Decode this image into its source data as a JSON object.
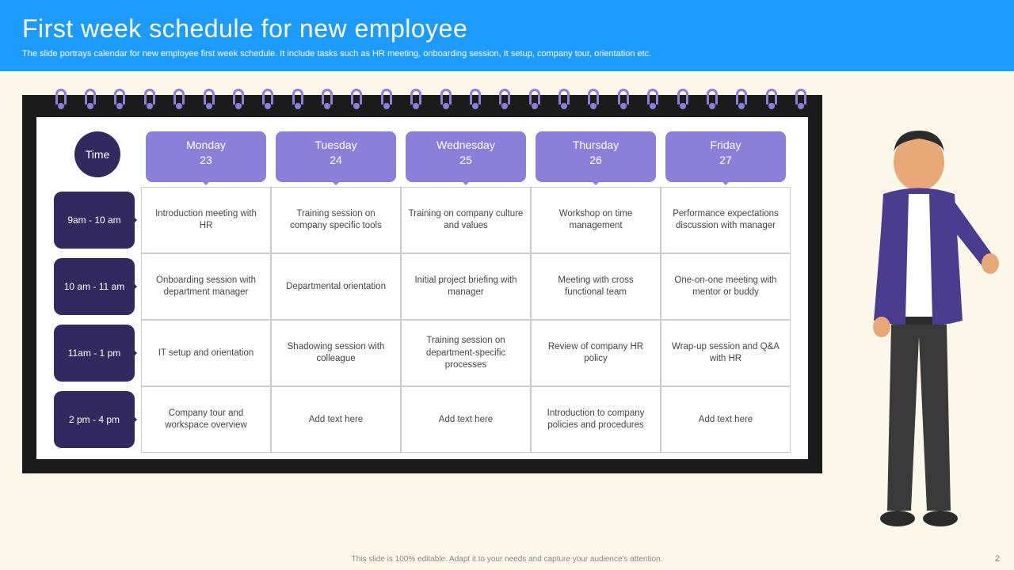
{
  "header": {
    "title": "First week schedule for new employee",
    "subtitle": "The slide portrays calendar for new employee first week schedule. It include tasks such as HR meeting, onboarding session, It setup, company tour, orientation etc."
  },
  "table": {
    "time_label": "Time",
    "days": [
      {
        "name": "Monday",
        "date": "23"
      },
      {
        "name": "Tuesday",
        "date": "24"
      },
      {
        "name": "Wednesday",
        "date": "25"
      },
      {
        "name": "Thursday",
        "date": "26"
      },
      {
        "name": "Friday",
        "date": "27"
      }
    ],
    "rows": [
      {
        "time": "9am - 10 am",
        "cells": [
          "Introduction meeting with HR",
          "Training session on company specific tools",
          "Training on company culture and values",
          "Workshop on time management",
          "Performance expectations discussion with manager"
        ]
      },
      {
        "time": "10 am - 11 am",
        "cells": [
          "Onboarding session with department manager",
          "Departmental orientation",
          "Initial project briefing with manager",
          "Meeting with cross functional team",
          "One-on-one meeting with mentor or buddy"
        ]
      },
      {
        "time": "11am - 1 pm",
        "cells": [
          "IT setup and orientation",
          "Shadowing session with colleague",
          "Training session on department-specific processes",
          "Review of company HR policy",
          "Wrap-up session and Q&A with HR"
        ]
      },
      {
        "time": "2 pm - 4 pm",
        "cells": [
          "Company tour and workspace overview",
          "Add text here",
          "Add text here",
          "Introduction to company policies and procedures",
          "Add text here"
        ]
      }
    ]
  },
  "footer": "This slide is 100% editable. Adapt it to your needs and capture your audience's attention.",
  "page_number": "2"
}
